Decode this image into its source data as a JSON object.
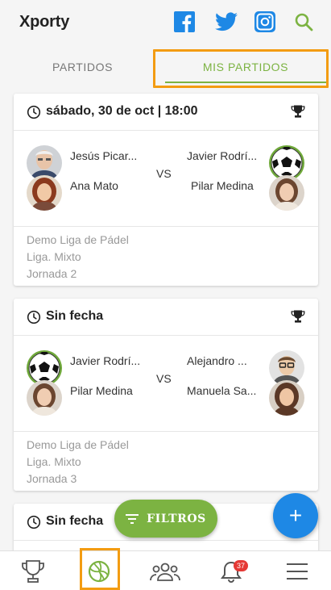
{
  "app": {
    "title": "Xporty"
  },
  "tabs": {
    "partidos": "PARTIDOS",
    "mis_partidos": "MIS PARTIDOS",
    "active": "mis_partidos"
  },
  "matches": [
    {
      "date": "sábado, 30 de oct | 18:00",
      "left_players": [
        "Jesús Picar...",
        "Ana Mato"
      ],
      "right_players": [
        "Javier Rodrí...",
        "Pilar Medina"
      ],
      "vs": "VS",
      "league": "Demo Liga de Pádel",
      "category": "Liga. Mixto",
      "round": "Jornada 2"
    },
    {
      "date": "Sin fecha",
      "left_players": [
        "Javier Rodrí...",
        "Pilar Medina"
      ],
      "right_players": [
        "Alejandro ...",
        "Manuela Sa..."
      ],
      "vs": "VS",
      "league": "Demo Liga de Pádel",
      "category": "Liga. Mixto",
      "round": "Jornada 3"
    },
    {
      "date": "Sin fecha"
    }
  ],
  "filters_button": "FILTROS",
  "add_button": "+",
  "bottom_nav": {
    "notifications_badge": "37"
  },
  "colors": {
    "accent_green": "#7cb342",
    "fab_blue": "#1e88e5",
    "highlight": "#f39c12",
    "badge_red": "#e53935"
  },
  "icons": [
    "facebook-icon",
    "twitter-icon",
    "instagram-icon",
    "search-icon",
    "clock-icon",
    "trophy-icon",
    "filter-icon",
    "plus-icon",
    "volleyball-icon",
    "group-icon",
    "bell-icon",
    "menu-icon"
  ]
}
